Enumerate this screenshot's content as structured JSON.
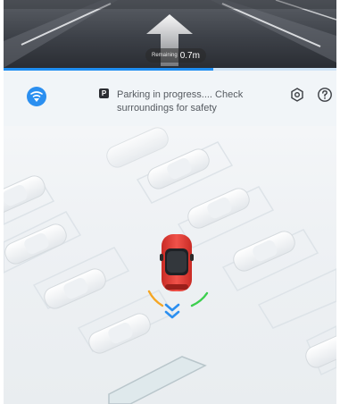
{
  "camera": {
    "remaining_label": "Remaining",
    "remaining_value": "0.7m",
    "icon": "straight-up-arrow"
  },
  "progress": {
    "fraction": 0.63,
    "color": "#1f8ef1"
  },
  "status": {
    "mode_icon": "parking-assist-icon",
    "badge": "P",
    "message": "Parking in progress.... Check surroundings for safety"
  },
  "toolbar": {
    "settings_icon": "gear-icon",
    "help_icon": "question-icon"
  },
  "vehicle": {
    "color": "#e8403a"
  },
  "colors": {
    "accent": "#2b8ff0",
    "sensor_orange": "#f5a623",
    "sensor_green": "#3ccf4e"
  }
}
